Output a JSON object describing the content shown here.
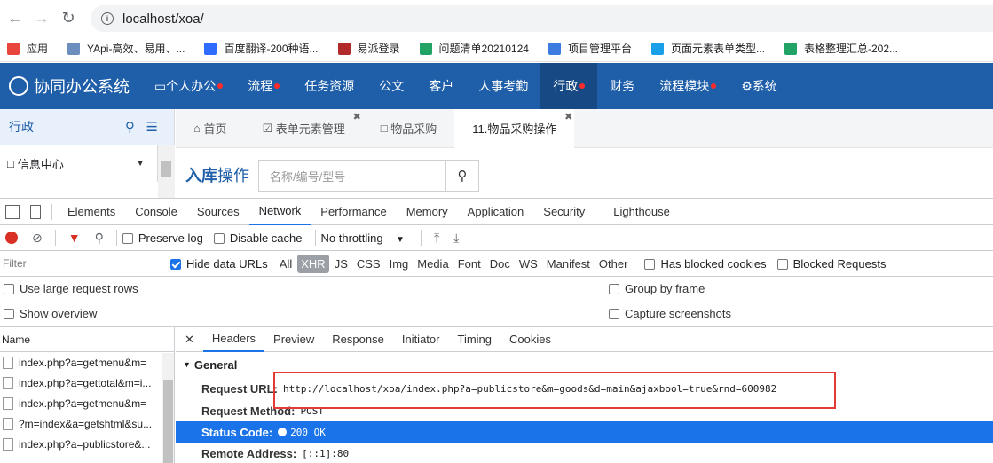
{
  "browser": {
    "url": "localhost/xoa/",
    "bookmarks": [
      {
        "label": "应用",
        "color": "#e8453c"
      },
      {
        "label": "YApi-高效、易用、...",
        "color": "#6c8ebf"
      },
      {
        "label": "百度翻译-200种语...",
        "color": "#2f6bff"
      },
      {
        "label": "易派登录",
        "color": "#b02a2a"
      },
      {
        "label": "问题清单20210124",
        "color": "#21a366"
      },
      {
        "label": "项目管理平台",
        "color": "#3d7be0"
      },
      {
        "label": "页面元素表单类型...",
        "color": "#1aa0e8"
      },
      {
        "label": "表格整理汇总-202...",
        "color": "#21a366"
      }
    ]
  },
  "app": {
    "brand": "协同办公系统",
    "menu": [
      {
        "label": "个人办公",
        "dot": true
      },
      {
        "label": "流程",
        "dot": true
      },
      {
        "label": "任务资源",
        "dot": false
      },
      {
        "label": "公文",
        "dot": false
      },
      {
        "label": "客户",
        "dot": false
      },
      {
        "label": "人事考勤",
        "dot": false
      },
      {
        "label": "行政",
        "dot": true
      },
      {
        "label": "财务",
        "dot": false
      },
      {
        "label": "流程模块",
        "dot": true
      },
      {
        "label": "系统",
        "dot": false
      }
    ],
    "sidebar_title": "行政",
    "sidebar_item": "信息中心",
    "tabs": [
      "首页",
      "表单元素管理",
      "物品采购",
      "11.物品采购操作"
    ],
    "page_title_bold": "入库",
    "page_title_rest": "操作",
    "search_placeholder": "名称/编号/型号"
  },
  "devtools": {
    "tabs": [
      "Elements",
      "Console",
      "Sources",
      "Network",
      "Performance",
      "Memory",
      "Application",
      "Security",
      "Lighthouse"
    ],
    "active_tab": "Network",
    "toolbar": {
      "preserve_log": "Preserve log",
      "disable_cache": "Disable cache",
      "throttling": "No throttling"
    },
    "filter": {
      "placeholder": "Filter",
      "hide_data_urls": "Hide data URLs",
      "types": [
        "All",
        "XHR",
        "JS",
        "CSS",
        "Img",
        "Media",
        "Font",
        "Doc",
        "WS",
        "Manifest",
        "Other"
      ],
      "active_type": "XHR",
      "has_blocked_cookies": "Has blocked cookies",
      "blocked_requests": "Blocked Requests"
    },
    "options": {
      "large_rows": "Use large request rows",
      "overview": "Show overview",
      "group_by_frame": "Group by frame",
      "capture_screenshots": "Capture screenshots"
    },
    "requests_header": "Name",
    "requests": [
      "index.php?a=getmenu&m=",
      "index.php?a=gettotal&m=i...",
      "index.php?a=getmenu&m=",
      "?m=index&a=getshtml&su...",
      "index.php?a=publicstore&..."
    ],
    "detail_tabs": [
      "Headers",
      "Preview",
      "Response",
      "Initiator",
      "Timing",
      "Cookies"
    ],
    "active_detail_tab": "Headers",
    "general_title": "General",
    "request_url_label": "Request URL:",
    "request_url": "http://localhost/xoa/index.php?a=publicstore&m=goods&d=main&ajaxbool=true&rnd=600982",
    "request_method_label": "Request Method:",
    "request_method": "POST",
    "status_code_label": "Status Code:",
    "status_code": "200  OK",
    "remote_address_label": "Remote Address:",
    "remote_address": "[::1]:80"
  }
}
